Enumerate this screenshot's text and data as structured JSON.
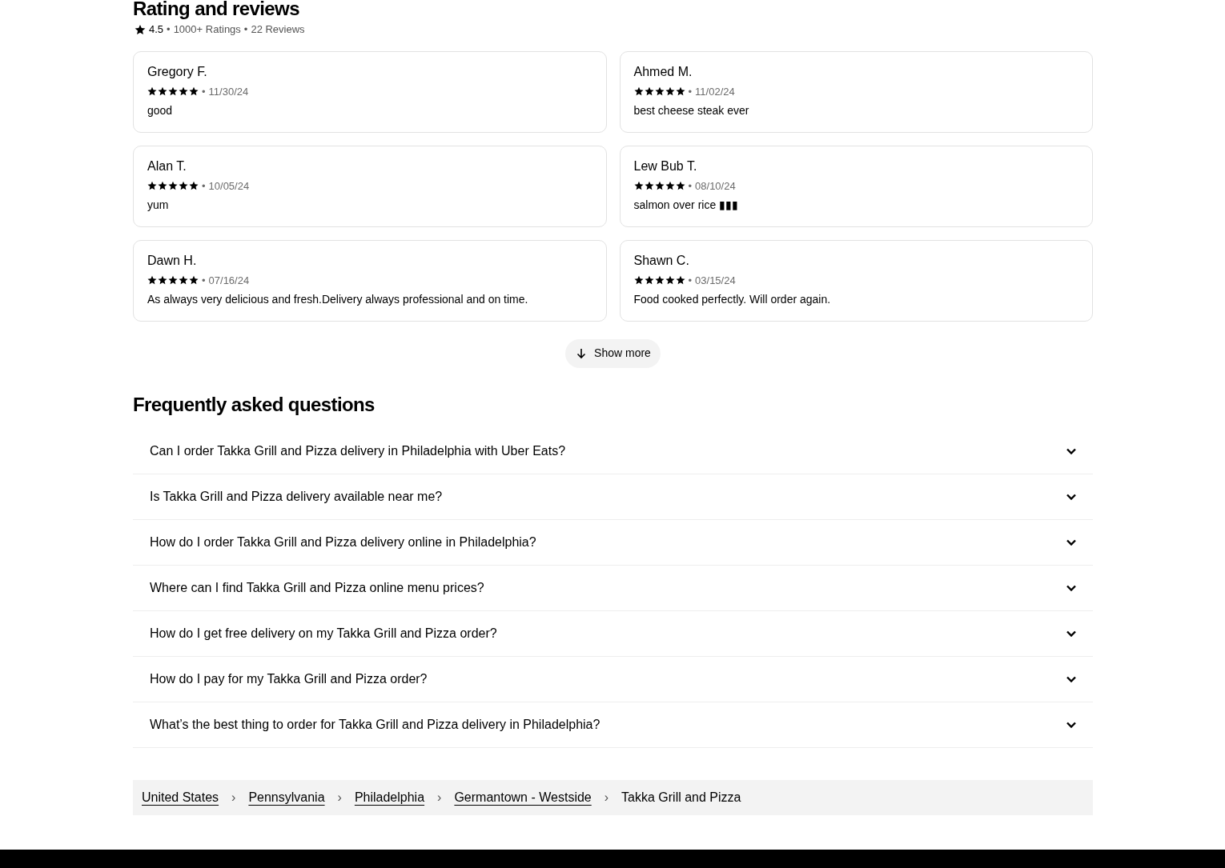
{
  "section_title": "Rating and reviews",
  "summary": {
    "rating": "4.5",
    "separator_1": "•",
    "ratings_count": "1000+ Ratings",
    "separator_2": "•",
    "reviews_count": "22 Reviews"
  },
  "reviews": [
    {
      "name": "Gregory F.",
      "stars": 5,
      "separator": "•",
      "date": "11/30/24",
      "text": "good"
    },
    {
      "name": "Ahmed M.",
      "stars": 5,
      "separator": "•",
      "date": "11/02/24",
      "text": "best cheese steak ever"
    },
    {
      "name": "Alan T.",
      "stars": 5,
      "separator": "•",
      "date": "10/05/24",
      "text": "yum"
    },
    {
      "name": "Lew Bub T.",
      "stars": 5,
      "separator": "•",
      "date": "08/10/24",
      "text": "salmon over rice ▮▮▮"
    },
    {
      "name": "Dawn H.",
      "stars": 5,
      "separator": "•",
      "date": "07/16/24",
      "text": "As always very delicious and fresh.Delivery always professional and on time."
    },
    {
      "name": "Shawn C.",
      "stars": 5,
      "separator": "•",
      "date": "03/15/24",
      "text": "Food cooked perfectly. Will order again."
    }
  ],
  "show_more": "Show more",
  "faq_title": "Frequently asked questions",
  "faq": [
    {
      "question": "Can I order Takka Grill and Pizza delivery in Philadelphia with Uber Eats?",
      "expanded": false
    },
    {
      "question": "Is Takka Grill and Pizza delivery available near me?",
      "expanded": false
    },
    {
      "question": "How do I order Takka Grill and Pizza delivery online in Philadelphia?",
      "expanded": false
    },
    {
      "question": "Where can I find Takka Grill and Pizza online menu prices?",
      "expanded": false
    },
    {
      "question": "How do I get free delivery on my Takka Grill and Pizza order?",
      "expanded": false
    },
    {
      "question": "How do I pay for my Takka Grill and Pizza order?",
      "expanded": false
    },
    {
      "question": "What’s the best thing to order for Takka Grill and Pizza delivery in Philadelphia?",
      "expanded": false
    }
  ],
  "breadcrumb": {
    "separator": "›",
    "items": [
      {
        "label": "United States",
        "kind": "link"
      },
      {
        "label": "Pennsylvania",
        "kind": "link"
      },
      {
        "label": "Philadelphia",
        "kind": "link"
      },
      {
        "label": "Germantown - Westside",
        "kind": "link"
      },
      {
        "label": "Takka Grill and Pizza",
        "kind": "current"
      }
    ]
  }
}
